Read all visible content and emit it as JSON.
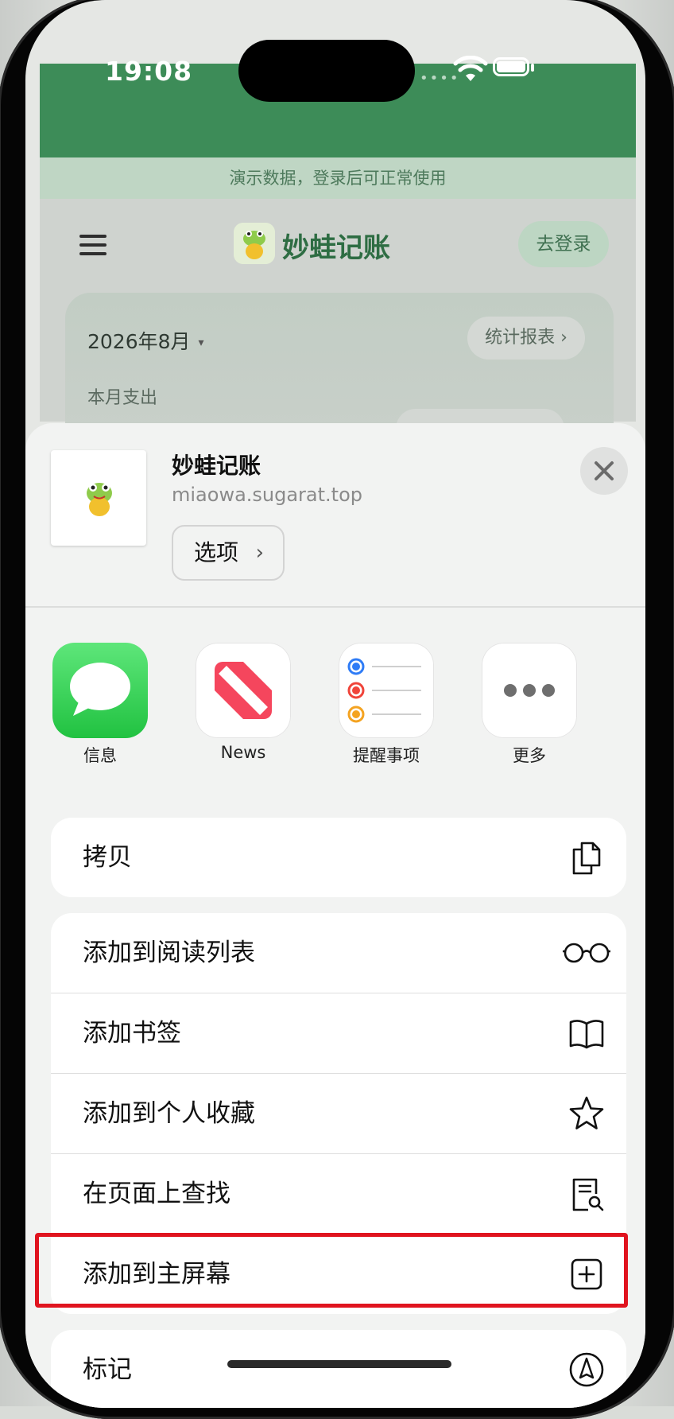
{
  "status_bar": {
    "time": "19:08",
    "signal": "••••"
  },
  "webpage": {
    "demo_banner": "演示数据，登录后可正常使用",
    "app_title": "妙蛙记账",
    "login_button": "去登录",
    "month": "2026年8月",
    "month_caret": "▾",
    "report_button": "统计报表 ›",
    "monthly_expense_label": "本月支出"
  },
  "share_sheet": {
    "title": "妙蛙记账",
    "url": "miaowa.sugarat.top",
    "options_label": "选项",
    "options_chevron": "›",
    "apps": [
      {
        "label": "信息",
        "icon": "messages-icon"
      },
      {
        "label": "News",
        "icon": "news-icon"
      },
      {
        "label": "提醒事项",
        "icon": "reminders-icon"
      },
      {
        "label": "更多",
        "icon": "more-icon"
      }
    ],
    "copy_group": [
      {
        "label": "拷贝",
        "icon": "copy-icon"
      }
    ],
    "actions_group": [
      {
        "label": "添加到阅读列表",
        "icon": "glasses-icon"
      },
      {
        "label": "添加书签",
        "icon": "book-icon"
      },
      {
        "label": "添加到个人收藏",
        "icon": "star-icon"
      },
      {
        "label": "在页面上查找",
        "icon": "find-on-page-icon"
      },
      {
        "label": "添加到主屏幕",
        "icon": "add-square-icon"
      }
    ],
    "markup_group": [
      {
        "label": "标记",
        "icon": "markup-icon"
      }
    ]
  },
  "colors": {
    "header_green": "#3d8c58",
    "highlight_red": "#e0141f"
  }
}
